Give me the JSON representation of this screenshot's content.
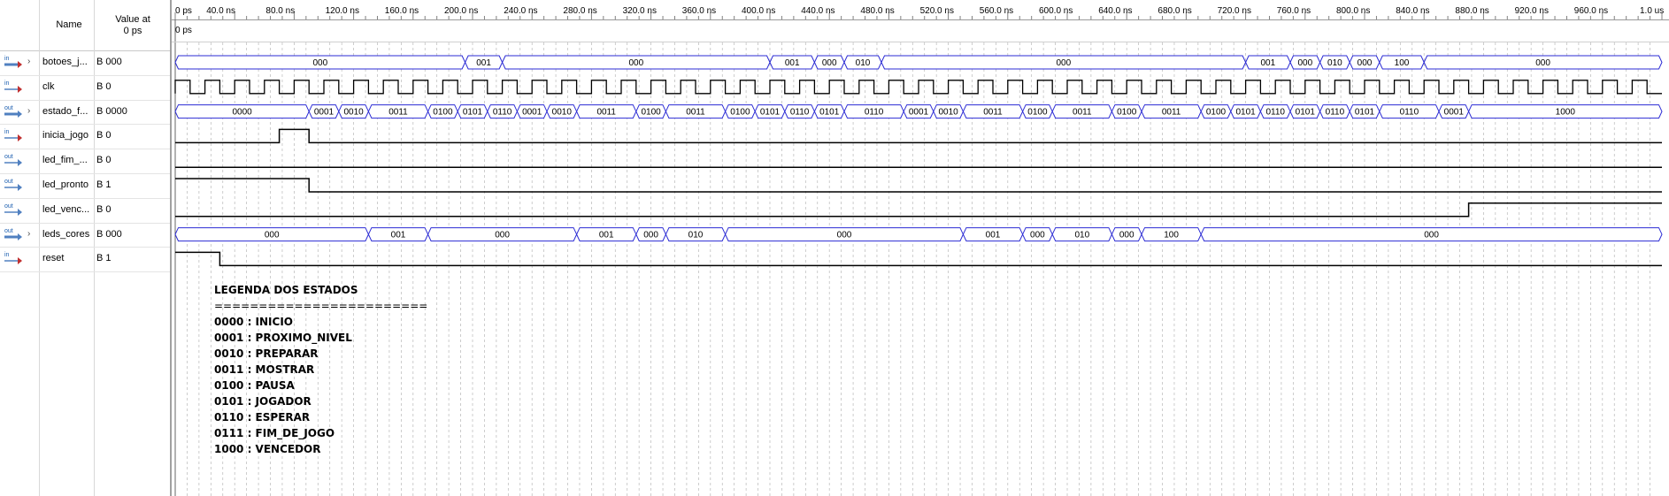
{
  "window": {
    "col_name": "Name",
    "col_value": "Value at",
    "col_value2": "0 ps",
    "cursor_label": "0 ps"
  },
  "ruler": {
    "start_label": "0 ps",
    "ticks": [
      "40.0 ns",
      "80.0 ns",
      "120.0 ns",
      "160.0 ns",
      "200.0 ns",
      "240.0 ns",
      "280.0 ns",
      "320.0 ns",
      "360.0 ns",
      "400.0 ns",
      "440.0 ns",
      "480.0 ns",
      "520.0 ns",
      "560.0 ns",
      "600.0 ns",
      "640.0 ns",
      "680.0 ns",
      "720.0 ns",
      "760.0 ns",
      "800.0 ns",
      "840.0 ns",
      "880.0 ns",
      "920.0 ns",
      "960.0 ns"
    ],
    "end_label": "1.0 us",
    "ns_per_tick": 40,
    "total_ns": 1000
  },
  "signals": [
    {
      "type": "in",
      "expandable": true,
      "name": "botoes_j...",
      "value": "B 000",
      "kind": "bus",
      "segments": [
        {
          "s": 0,
          "e": 195,
          "v": "000"
        },
        {
          "s": 195,
          "e": 220,
          "v": "001"
        },
        {
          "s": 220,
          "e": 400,
          "v": "000"
        },
        {
          "s": 400,
          "e": 430,
          "v": "001"
        },
        {
          "s": 430,
          "e": 450,
          "v": "000"
        },
        {
          "s": 450,
          "e": 475,
          "v": "010"
        },
        {
          "s": 475,
          "e": 720,
          "v": "000"
        },
        {
          "s": 720,
          "e": 750,
          "v": "001"
        },
        {
          "s": 750,
          "e": 770,
          "v": "000"
        },
        {
          "s": 770,
          "e": 790,
          "v": "010"
        },
        {
          "s": 790,
          "e": 810,
          "v": "000"
        },
        {
          "s": 810,
          "e": 840,
          "v": "100"
        },
        {
          "s": 840,
          "e": 1000,
          "v": "000"
        }
      ]
    },
    {
      "type": "in",
      "expandable": false,
      "name": "clk",
      "value": "B 0",
      "kind": "clock",
      "period": 20
    },
    {
      "type": "out",
      "expandable": true,
      "name": "estado_f...",
      "value": "B 0000",
      "kind": "bus",
      "segments": [
        {
          "s": 0,
          "e": 90,
          "v": "0000"
        },
        {
          "s": 90,
          "e": 110,
          "v": "0001"
        },
        {
          "s": 110,
          "e": 130,
          "v": "0010"
        },
        {
          "s": 130,
          "e": 170,
          "v": "0011"
        },
        {
          "s": 170,
          "e": 190,
          "v": "0100"
        },
        {
          "s": 190,
          "e": 210,
          "v": "0101"
        },
        {
          "s": 210,
          "e": 230,
          "v": "0110"
        },
        {
          "s": 230,
          "e": 250,
          "v": "0001"
        },
        {
          "s": 250,
          "e": 270,
          "v": "0010"
        },
        {
          "s": 270,
          "e": 310,
          "v": "0011"
        },
        {
          "s": 310,
          "e": 330,
          "v": "0100"
        },
        {
          "s": 330,
          "e": 370,
          "v": "0011"
        },
        {
          "s": 370,
          "e": 390,
          "v": "0100"
        },
        {
          "s": 390,
          "e": 410,
          "v": "0101"
        },
        {
          "s": 410,
          "e": 430,
          "v": "0110"
        },
        {
          "s": 430,
          "e": 450,
          "v": "0101"
        },
        {
          "s": 450,
          "e": 490,
          "v": "0110"
        },
        {
          "s": 490,
          "e": 510,
          "v": "0001"
        },
        {
          "s": 510,
          "e": 530,
          "v": "0010"
        },
        {
          "s": 530,
          "e": 570,
          "v": "0011"
        },
        {
          "s": 570,
          "e": 590,
          "v": "0100"
        },
        {
          "s": 590,
          "e": 630,
          "v": "0011"
        },
        {
          "s": 630,
          "e": 650,
          "v": "0100"
        },
        {
          "s": 650,
          "e": 690,
          "v": "0011"
        },
        {
          "s": 690,
          "e": 710,
          "v": "0100"
        },
        {
          "s": 710,
          "e": 730,
          "v": "0101"
        },
        {
          "s": 730,
          "e": 750,
          "v": "0110"
        },
        {
          "s": 750,
          "e": 770,
          "v": "0101"
        },
        {
          "s": 770,
          "e": 790,
          "v": "0110"
        },
        {
          "s": 790,
          "e": 810,
          "v": "0101"
        },
        {
          "s": 810,
          "e": 850,
          "v": "0110"
        },
        {
          "s": 850,
          "e": 870,
          "v": "0001"
        },
        {
          "s": 870,
          "e": 1000,
          "v": "1000"
        }
      ]
    },
    {
      "type": "in",
      "expandable": false,
      "name": "inicia_jogo",
      "value": "B 0",
      "kind": "bit",
      "highs": [
        [
          70,
          90
        ]
      ]
    },
    {
      "type": "out",
      "expandable": false,
      "name": "led_fim_...",
      "value": "B 0",
      "kind": "bit",
      "highs": []
    },
    {
      "type": "out",
      "expandable": false,
      "name": "led_pronto",
      "value": "B 1",
      "kind": "bit",
      "highs": [
        [
          0,
          90
        ]
      ]
    },
    {
      "type": "out",
      "expandable": false,
      "name": "led_venc...",
      "value": "B 0",
      "kind": "bit",
      "highs": [
        [
          870,
          1000
        ]
      ]
    },
    {
      "type": "out",
      "expandable": true,
      "name": "leds_cores",
      "value": "B 000",
      "kind": "bus",
      "segments": [
        {
          "s": 0,
          "e": 130,
          "v": "000"
        },
        {
          "s": 130,
          "e": 170,
          "v": "001"
        },
        {
          "s": 170,
          "e": 270,
          "v": "000"
        },
        {
          "s": 270,
          "e": 310,
          "v": "001"
        },
        {
          "s": 310,
          "e": 330,
          "v": "000"
        },
        {
          "s": 330,
          "e": 370,
          "v": "010"
        },
        {
          "s": 370,
          "e": 530,
          "v": "000"
        },
        {
          "s": 530,
          "e": 570,
          "v": "001"
        },
        {
          "s": 570,
          "e": 590,
          "v": "000"
        },
        {
          "s": 590,
          "e": 630,
          "v": "010"
        },
        {
          "s": 630,
          "e": 650,
          "v": "000"
        },
        {
          "s": 650,
          "e": 690,
          "v": "100"
        },
        {
          "s": 690,
          "e": 1000,
          "v": "000"
        }
      ]
    },
    {
      "type": "in",
      "expandable": false,
      "name": "reset",
      "value": "B 1",
      "kind": "bit",
      "highs": [
        [
          0,
          30
        ]
      ]
    }
  ],
  "legend": {
    "title": "LEGENDA DOS ESTADOS",
    "separator": "========================",
    "lines": [
      "0000 : INICIO",
      "0001 : PROXIMO_NIVEL",
      "0010 : PREPARAR",
      "0011 : MOSTRAR",
      "0100 : PAUSA",
      "0101 : JOGADOR",
      "0110 : ESPERAR",
      "0111 : FIM_DE_JOGO",
      "1000 : VENCEDOR"
    ]
  },
  "colors": {
    "wave": "#000000",
    "bus_edge": "#2b2bd4",
    "grid": "#b8b8b8"
  }
}
